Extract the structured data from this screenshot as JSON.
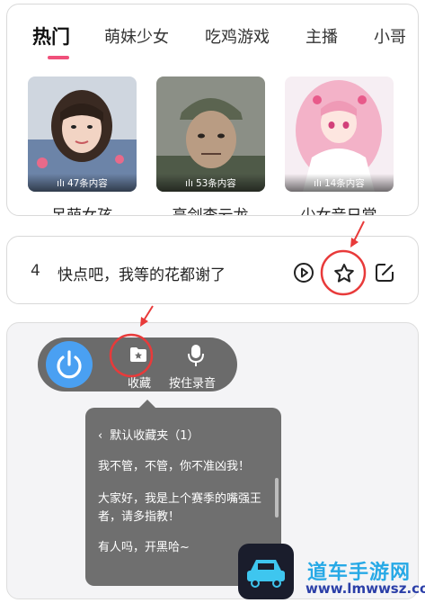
{
  "tabs": [
    {
      "label": "热门",
      "active": true
    },
    {
      "label": "萌妹少女",
      "active": false
    },
    {
      "label": "吃鸡游戏",
      "active": false
    },
    {
      "label": "主播",
      "active": false
    },
    {
      "label": "小哥",
      "active": false
    }
  ],
  "collections": [
    {
      "title": "呆萌女孩",
      "count": "47条内容"
    },
    {
      "title": "亮剑李云龙",
      "count": "53条内容"
    },
    {
      "title": "少女音日常",
      "count": "14条内容"
    }
  ],
  "voice_line": {
    "number": "4",
    "text": "快点吧，我等的花都谢了"
  },
  "toolbar": {
    "collect_label": "收藏",
    "record_label": "按住录音"
  },
  "popup": {
    "header": "默认收藏夹（1）",
    "items": [
      "我不管，不管，你不准凶我！",
      "大家好，我是上个赛季的嘴强王者，请多指教！",
      "有人吗，开黑哈~"
    ]
  },
  "watermark": {
    "title": "道车手游网",
    "url": "www.lmwwsz.com"
  },
  "colors": {
    "accent_pink": "#f0507a",
    "annotation_red": "#e83a3a",
    "power_blue": "#4aa0f2"
  }
}
